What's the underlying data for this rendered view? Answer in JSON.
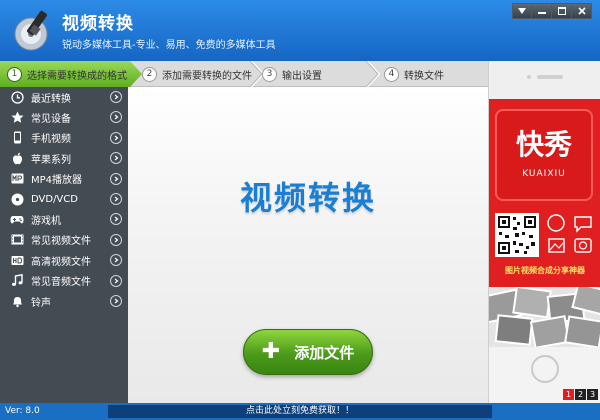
{
  "header": {
    "title": "视频转换",
    "subtitle": "锐动多媒体工具-专业、易用、免费的多媒体工具",
    "window_controls": [
      "menu-icon",
      "minimize-icon",
      "maximize-icon",
      "close-icon"
    ]
  },
  "steps": [
    {
      "num": "1",
      "label": "选择需要转换成的格式"
    },
    {
      "num": "2",
      "label": "添加需要转换的文件"
    },
    {
      "num": "3",
      "label": "输出设置"
    },
    {
      "num": "4",
      "label": "转换文件"
    }
  ],
  "sidebar": {
    "items": [
      {
        "label": "最近转换",
        "icon": "clock-icon"
      },
      {
        "label": "常见设备",
        "icon": "star-icon"
      },
      {
        "label": "手机视频",
        "icon": "phone-icon"
      },
      {
        "label": "苹果系列",
        "icon": "apple-icon"
      },
      {
        "label": "MP4播放器",
        "icon": "mp4-icon"
      },
      {
        "label": "DVD/VCD",
        "icon": "disc-icon"
      },
      {
        "label": "游戏机",
        "icon": "gamepad-icon"
      },
      {
        "label": "常见视频文件",
        "icon": "film-icon"
      },
      {
        "label": "高清视频文件",
        "icon": "hd-icon"
      },
      {
        "label": "常见音频文件",
        "icon": "music-icon"
      },
      {
        "label": "铃声",
        "icon": "bell-icon"
      }
    ]
  },
  "main": {
    "title": "视频转换",
    "add_button": "添加文件"
  },
  "ad": {
    "brand": "快秀",
    "brand_en": "KUAIXIU",
    "slogan": "图片视频合成分享神器",
    "pages": [
      "1",
      "2",
      "3"
    ],
    "active_page": "1"
  },
  "status": {
    "version": "Ver: 8.0",
    "notice": "点击此处立刻免费获取！！"
  },
  "colors": {
    "header": "#1e78d6",
    "step_active": "#6bbf2a",
    "sidebar": "#444c53",
    "title_blue": "#1a7fd3",
    "ad_red": "#e02020"
  }
}
